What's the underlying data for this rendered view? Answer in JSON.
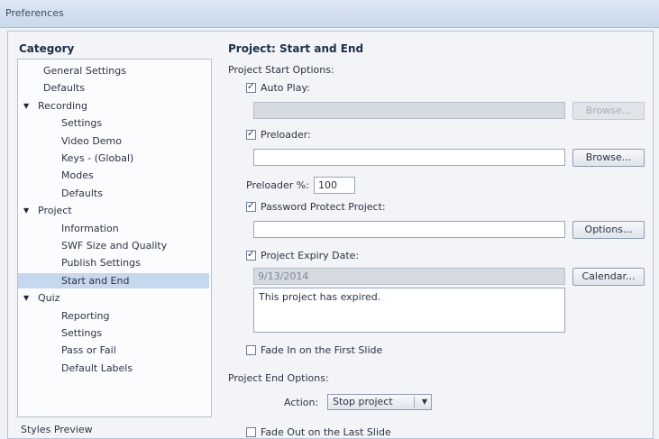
{
  "window": {
    "title": "Preferences"
  },
  "category": {
    "heading": "Category",
    "items": [
      {
        "label": "General Settings",
        "level": 1,
        "expander": "",
        "selected": false
      },
      {
        "label": "Defaults",
        "level": 1,
        "expander": "",
        "selected": false
      },
      {
        "label": "Recording",
        "level": 0,
        "expander": "▼",
        "selected": false
      },
      {
        "label": "Settings",
        "level": 2,
        "expander": "",
        "selected": false
      },
      {
        "label": "Video Demo",
        "level": 2,
        "expander": "",
        "selected": false
      },
      {
        "label": "Keys - (Global)",
        "level": 2,
        "expander": "",
        "selected": false
      },
      {
        "label": "Modes",
        "level": 2,
        "expander": "",
        "selected": false
      },
      {
        "label": "Defaults",
        "level": 2,
        "expander": "",
        "selected": false
      },
      {
        "label": "Project",
        "level": 0,
        "expander": "▼",
        "selected": false
      },
      {
        "label": "Information",
        "level": 2,
        "expander": "",
        "selected": false
      },
      {
        "label": "SWF Size and Quality",
        "level": 2,
        "expander": "",
        "selected": false
      },
      {
        "label": "Publish Settings",
        "level": 2,
        "expander": "",
        "selected": false
      },
      {
        "label": "Start and End",
        "level": 2,
        "expander": "",
        "selected": true
      },
      {
        "label": "Quiz",
        "level": 0,
        "expander": "▼",
        "selected": false
      },
      {
        "label": "Reporting",
        "level": 2,
        "expander": "",
        "selected": false
      },
      {
        "label": "Settings",
        "level": 2,
        "expander": "",
        "selected": false
      },
      {
        "label": "Pass or Fail",
        "level": 2,
        "expander": "",
        "selected": false
      },
      {
        "label": "Default Labels",
        "level": 2,
        "expander": "",
        "selected": false
      }
    ],
    "styles_preview": "Styles Preview"
  },
  "content": {
    "title": "Project: Start and End",
    "start_options_heading": "Project Start Options:",
    "auto_play": {
      "label": "Auto Play:",
      "checked": true,
      "value": "",
      "button": "Browse..."
    },
    "preloader": {
      "label": "Preloader:",
      "checked": true,
      "value": "",
      "button": "Browse..."
    },
    "preloader_pct": {
      "label": "Preloader %:",
      "value": "100"
    },
    "password": {
      "label": "Password Protect Project:",
      "checked": true,
      "value": "",
      "button": "Options..."
    },
    "expiry": {
      "label": "Project Expiry Date:",
      "checked": true,
      "date": "9/13/2014",
      "button": "Calendar...",
      "message": "This project has expired."
    },
    "fade_in": {
      "label": "Fade In on the First Slide",
      "checked": false
    },
    "end_options_heading": "Project End Options:",
    "action": {
      "label": "Action:",
      "value": "Stop project"
    },
    "fade_out": {
      "label": "Fade Out on the Last Slide",
      "checked": false
    }
  }
}
